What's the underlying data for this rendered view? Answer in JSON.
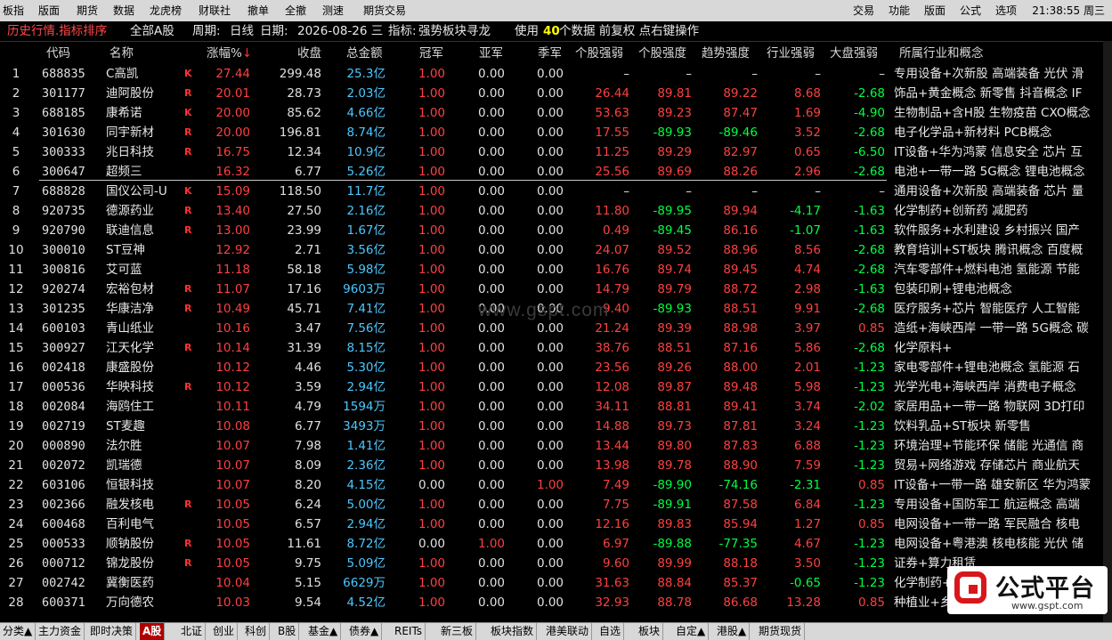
{
  "menu": {
    "left": [
      "板指",
      "版面",
      "期货",
      "数据",
      "龙虎榜",
      "财联社",
      "撤单",
      "全撤",
      "测速",
      "期货交易"
    ],
    "right": [
      "交易",
      "功能",
      "版面",
      "公式",
      "选项"
    ],
    "clock": "21:38:55 周三"
  },
  "status": {
    "title": "历史行情.指标排序",
    "market": "全部A股",
    "period_label": "周期:",
    "period": "日线",
    "date_label": "日期:",
    "date": "2026-08-26 三",
    "indicator_label": "指标:",
    "indicator": "强势板块寻龙",
    "use_text": "使用",
    "use_count": "40",
    "use_suffix": "个数据 前复权 点右键操作"
  },
  "columns": {
    "code": "代码",
    "name": "名称",
    "pct": "涨幅%",
    "close": "收盘",
    "amount": "总金额",
    "n1": "冠军",
    "n2": "亚军",
    "n3": "季军",
    "s1": "个股强弱",
    "s2": "个股强度",
    "s3": "趋势强度",
    "s4": "行业强弱",
    "s5": "大盘强弱",
    "ind": "所属行业和概念"
  },
  "rows": [
    {
      "idx": "1",
      "code": "688835",
      "name": "C高凯",
      "flag": "K",
      "pct": "27.44",
      "close": "299.48",
      "amt": "25.3亿",
      "n1": "1.00",
      "n2": "0.00",
      "n3": "0.00",
      "s1": "–",
      "s2": "–",
      "s3": "–",
      "s4": "–",
      "s5": "–",
      "ind": "专用设备+次新股 高端装备 光伏 滑"
    },
    {
      "idx": "2",
      "code": "301177",
      "name": "迪阿股份",
      "flag": "R",
      "pct": "20.01",
      "close": "28.73",
      "amt": "2.03亿",
      "n1": "1.00",
      "n2": "0.00",
      "n3": "0.00",
      "s1": "26.44",
      "s2": "89.81",
      "s3": "89.22",
      "s4": "8.68",
      "s5": "-2.68",
      "ind": "饰品+黄金概念 新零售 抖音概念 IF"
    },
    {
      "idx": "3",
      "code": "688185",
      "name": "康希诺",
      "flag": "K",
      "pct": "20.00",
      "close": "85.62",
      "amt": "4.66亿",
      "n1": "1.00",
      "n2": "0.00",
      "n3": "0.00",
      "s1": "53.63",
      "s2": "89.23",
      "s3": "87.47",
      "s4": "1.69",
      "s5": "-4.90",
      "ind": "生物制品+含H股 生物疫苗 CXO概念"
    },
    {
      "idx": "4",
      "code": "301630",
      "name": "同宇新材",
      "flag": "R",
      "pct": "20.00",
      "close": "196.81",
      "amt": "8.74亿",
      "n1": "1.00",
      "n2": "0.00",
      "n3": "0.00",
      "s1": "17.55",
      "s2": "-89.93",
      "s3": "-89.46",
      "s4": "3.52",
      "s5": "-2.68",
      "ind": "电子化学品+新材料 PCB概念"
    },
    {
      "idx": "5",
      "code": "300333",
      "name": "兆日科技",
      "flag": "R",
      "pct": "16.75",
      "close": "12.34",
      "amt": "10.9亿",
      "n1": "1.00",
      "n2": "0.00",
      "n3": "0.00",
      "s1": "11.25",
      "s2": "89.29",
      "s3": "82.97",
      "s4": "0.65",
      "s5": "-6.50",
      "ind": "IT设备+华为鸿蒙 信息安全 芯片 互"
    },
    {
      "idx": "6",
      "code": "300647",
      "name": "超频三",
      "flag": "",
      "pct": "16.32",
      "close": "6.77",
      "amt": "5.26亿",
      "n1": "1.00",
      "n2": "0.00",
      "n3": "0.00",
      "s1": "25.56",
      "s2": "89.69",
      "s3": "88.26",
      "s4": "2.96",
      "s5": "-2.68",
      "ind": "电池+一带一路 5G概念 锂电池概念"
    },
    {
      "idx": "7",
      "code": "688828",
      "name": "国仪公司-U",
      "flag": "K",
      "pct": "15.09",
      "close": "118.50",
      "amt": "11.7亿",
      "n1": "1.00",
      "n2": "0.00",
      "n3": "0.00",
      "s1": "–",
      "s2": "–",
      "s3": "–",
      "s4": "–",
      "s5": "–",
      "ind": "通用设备+次新股 高端装备 芯片 量"
    },
    {
      "idx": "8",
      "code": "920735",
      "name": "德源药业",
      "flag": "R",
      "pct": "13.40",
      "close": "27.50",
      "amt": "2.16亿",
      "n1": "1.00",
      "n2": "0.00",
      "n3": "0.00",
      "s1": "11.80",
      "s2": "-89.95",
      "s3": "89.94",
      "s4": "-4.17",
      "s5": "-1.63",
      "ind": "化学制药+创新药 减肥药"
    },
    {
      "idx": "9",
      "code": "920790",
      "name": "联迪信息",
      "flag": "R",
      "pct": "13.00",
      "close": "23.99",
      "amt": "1.67亿",
      "n1": "1.00",
      "n2": "0.00",
      "n3": "0.00",
      "s1": "0.49",
      "s2": "-89.45",
      "s3": "86.16",
      "s4": "-1.07",
      "s5": "-1.63",
      "ind": "软件服务+水利建设 乡村振兴 国产"
    },
    {
      "idx": "10",
      "code": "300010",
      "name": "ST豆神",
      "flag": "",
      "pct": "12.92",
      "close": "2.71",
      "amt": "3.56亿",
      "n1": "1.00",
      "n2": "0.00",
      "n3": "0.00",
      "s1": "24.07",
      "s2": "89.52",
      "s3": "88.96",
      "s4": "8.56",
      "s5": "-2.68",
      "ind": "教育培训+ST板块 腾讯概念 百度概"
    },
    {
      "idx": "11",
      "code": "300816",
      "name": "艾可蓝",
      "flag": "",
      "pct": "11.18",
      "close": "58.18",
      "amt": "5.98亿",
      "n1": "1.00",
      "n2": "0.00",
      "n3": "0.00",
      "s1": "16.76",
      "s2": "89.74",
      "s3": "89.45",
      "s4": "4.74",
      "s5": "-2.68",
      "ind": "汽车零部件+燃料电池 氢能源 节能"
    },
    {
      "idx": "12",
      "code": "920274",
      "name": "宏裕包材",
      "flag": "R",
      "pct": "11.07",
      "close": "17.16",
      "amt": "9603万",
      "n1": "1.00",
      "n2": "0.00",
      "n3": "0.00",
      "s1": "14.79",
      "s2": "89.79",
      "s3": "88.72",
      "s4": "2.98",
      "s5": "-1.63",
      "ind": "包装印刷+锂电池概念"
    },
    {
      "idx": "13",
      "code": "301235",
      "name": "华康洁净",
      "flag": "R",
      "pct": "10.49",
      "close": "45.71",
      "amt": "7.41亿",
      "n1": "1.00",
      "n2": "0.00",
      "n3": "0.00",
      "s1": "9.40",
      "s2": "-89.93",
      "s3": "88.51",
      "s4": "9.91",
      "s5": "-2.68",
      "ind": "医疗服务+芯片 智能医疗 人工智能"
    },
    {
      "idx": "14",
      "code": "600103",
      "name": "青山纸业",
      "flag": "",
      "pct": "10.16",
      "close": "3.47",
      "amt": "7.56亿",
      "n1": "1.00",
      "n2": "0.00",
      "n3": "0.00",
      "s1": "21.24",
      "s2": "89.39",
      "s3": "88.98",
      "s4": "3.97",
      "s5": "0.85",
      "ind": "造纸+海峡西岸 一带一路 5G概念 碳"
    },
    {
      "idx": "15",
      "code": "300927",
      "name": "江天化学",
      "flag": "R",
      "pct": "10.14",
      "close": "31.39",
      "amt": "8.15亿",
      "n1": "1.00",
      "n2": "0.00",
      "n3": "0.00",
      "s1": "38.76",
      "s2": "88.51",
      "s3": "87.16",
      "s4": "5.86",
      "s5": "-2.68",
      "ind": "化学原料+"
    },
    {
      "idx": "16",
      "code": "002418",
      "name": "康盛股份",
      "flag": "",
      "pct": "10.12",
      "close": "4.46",
      "amt": "5.30亿",
      "n1": "1.00",
      "n2": "0.00",
      "n3": "0.00",
      "s1": "23.56",
      "s2": "89.26",
      "s3": "88.00",
      "s4": "2.01",
      "s5": "-1.23",
      "ind": "家电零部件+锂电池概念 氢能源 石"
    },
    {
      "idx": "17",
      "code": "000536",
      "name": "华映科技",
      "flag": "R",
      "pct": "10.12",
      "close": "3.59",
      "amt": "2.94亿",
      "n1": "1.00",
      "n2": "0.00",
      "n3": "0.00",
      "s1": "12.08",
      "s2": "89.87",
      "s3": "89.48",
      "s4": "5.98",
      "s5": "-1.23",
      "ind": "光学光电+海峡西岸 消费电子概念"
    },
    {
      "idx": "18",
      "code": "002084",
      "name": "海鸥住工",
      "flag": "",
      "pct": "10.11",
      "close": "4.79",
      "amt": "1594万",
      "n1": "1.00",
      "n2": "0.00",
      "n3": "0.00",
      "s1": "34.11",
      "s2": "88.81",
      "s3": "89.41",
      "s4": "3.74",
      "s5": "-2.02",
      "ind": "家居用品+一带一路 物联网 3D打印"
    },
    {
      "idx": "19",
      "code": "002719",
      "name": "ST麦趣",
      "flag": "",
      "pct": "10.08",
      "close": "6.77",
      "amt": "3493万",
      "n1": "1.00",
      "n2": "0.00",
      "n3": "0.00",
      "s1": "14.88",
      "s2": "89.73",
      "s3": "87.81",
      "s4": "3.24",
      "s5": "-1.23",
      "ind": "饮料乳品+ST板块 新零售"
    },
    {
      "idx": "20",
      "code": "000890",
      "name": "法尔胜",
      "flag": "",
      "pct": "10.07",
      "close": "7.98",
      "amt": "1.41亿",
      "n1": "1.00",
      "n2": "0.00",
      "n3": "0.00",
      "s1": "13.44",
      "s2": "89.80",
      "s3": "87.83",
      "s4": "6.88",
      "s5": "-1.23",
      "ind": "环境治理+节能环保 储能 光通信 商"
    },
    {
      "idx": "21",
      "code": "002072",
      "name": "凯瑞德",
      "flag": "",
      "pct": "10.07",
      "close": "8.09",
      "amt": "2.36亿",
      "n1": "1.00",
      "n2": "0.00",
      "n3": "0.00",
      "s1": "13.98",
      "s2": "89.78",
      "s3": "88.90",
      "s4": "7.59",
      "s5": "-1.23",
      "ind": "贸易+网络游戏 存储芯片 商业航天"
    },
    {
      "idx": "22",
      "code": "603106",
      "name": "恒银科技",
      "flag": "",
      "pct": "10.07",
      "close": "8.20",
      "amt": "4.15亿",
      "n1": "0.00",
      "n2": "0.00",
      "n3": "1.00",
      "s1": "7.49",
      "s2": "-89.90",
      "s3": "-74.16",
      "s4": "-2.31",
      "s5": "0.85",
      "ind": "IT设备+一带一路 雄安新区 华为鸿蒙"
    },
    {
      "idx": "23",
      "code": "002366",
      "name": "融发核电",
      "flag": "R",
      "pct": "10.05",
      "close": "6.24",
      "amt": "5.00亿",
      "n1": "1.00",
      "n2": "0.00",
      "n3": "0.00",
      "s1": "7.75",
      "s2": "-89.91",
      "s3": "87.58",
      "s4": "6.84",
      "s5": "-1.23",
      "ind": "专用设备+国防军工 航运概念 高端"
    },
    {
      "idx": "24",
      "code": "600468",
      "name": "百利电气",
      "flag": "",
      "pct": "10.05",
      "close": "6.57",
      "amt": "2.94亿",
      "n1": "1.00",
      "n2": "0.00",
      "n3": "0.00",
      "s1": "12.16",
      "s2": "89.83",
      "s3": "85.94",
      "s4": "1.27",
      "s5": "0.85",
      "ind": "电网设备+一带一路 军民融合 核电"
    },
    {
      "idx": "25",
      "code": "000533",
      "name": "顺钠股份",
      "flag": "R",
      "pct": "10.05",
      "close": "11.61",
      "amt": "8.72亿",
      "n1": "0.00",
      "n2": "1.00",
      "n3": "0.00",
      "s1": "6.97",
      "s2": "-89.88",
      "s3": "-77.35",
      "s4": "4.67",
      "s5": "-1.23",
      "ind": "电网设备+粤港澳 核电核能 光伏 储"
    },
    {
      "idx": "26",
      "code": "000712",
      "name": "锦龙股份",
      "flag": "R",
      "pct": "10.05",
      "close": "9.75",
      "amt": "5.09亿",
      "n1": "1.00",
      "n2": "0.00",
      "n3": "0.00",
      "s1": "9.60",
      "s2": "89.99",
      "s3": "88.18",
      "s4": "3.50",
      "s5": "-1.23",
      "ind": "证券+算力租赁"
    },
    {
      "idx": "27",
      "code": "002742",
      "name": "冀衡医药",
      "flag": "",
      "pct": "10.04",
      "close": "5.15",
      "amt": "6629万",
      "n1": "1.00",
      "n2": "0.00",
      "n3": "0.00",
      "s1": "31.63",
      "s2": "88.84",
      "s3": "85.37",
      "s4": "-0.65",
      "s5": "-1.23",
      "ind": "化学制药+一带一路 维生素 职业教"
    },
    {
      "idx": "28",
      "code": "600371",
      "name": "万向德农",
      "flag": "",
      "pct": "10.03",
      "close": "9.54",
      "amt": "4.52亿",
      "n1": "1.00",
      "n2": "0.00",
      "n3": "0.00",
      "s1": "32.93",
      "s2": "88.78",
      "s3": "86.68",
      "s4": "13.28",
      "s5": "0.85",
      "ind": "种植业+乡村振兴 转基因 农业种植"
    }
  ],
  "watermark": "www.gspt.com",
  "logo": {
    "title": "公式平台",
    "url": "www.gspt.com"
  },
  "tabs": [
    "分类▲",
    "主力资金",
    "即时决策",
    "A股",
    "北证",
    "创业",
    "科创",
    "B股",
    "基金▲",
    "债券▲",
    "REITs",
    "新三板",
    "板块指数",
    "港美联动",
    "自选",
    "板块",
    "自定▲",
    "港股▲",
    "期货现货"
  ],
  "active_tab": "A股",
  "colors": {
    "up": "#ff4040",
    "down": "#00ff40",
    "amount": "#4dc8ff",
    "accent": "#ffff00",
    "status": "#ff4a4a"
  }
}
